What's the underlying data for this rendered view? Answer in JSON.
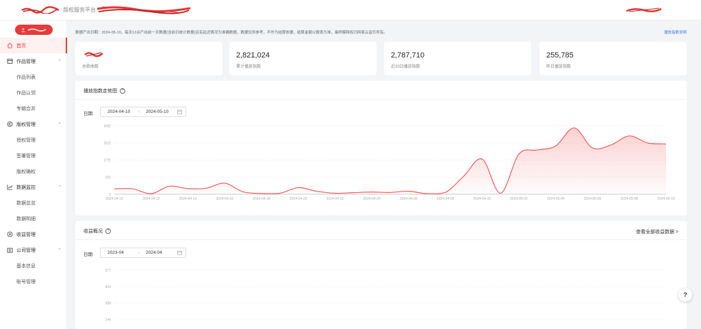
{
  "header": {
    "platform_label": "版权服务平台"
  },
  "sidebar": {
    "primary_button_icon": "upload-icon",
    "nav": [
      {
        "label": "首页",
        "type": "group",
        "active": true,
        "icon": "home-icon"
      },
      {
        "label": "作品管理",
        "type": "group",
        "expanded": true,
        "icon": "works-icon"
      },
      {
        "label": "作品列表",
        "type": "sub"
      },
      {
        "label": "作品认领",
        "type": "sub"
      },
      {
        "label": "专辑合并",
        "type": "sub"
      },
      {
        "label": "版权管理",
        "type": "group",
        "expanded": true,
        "icon": "copyright-icon"
      },
      {
        "label": "授权管理",
        "type": "sub"
      },
      {
        "label": "签署管理",
        "type": "sub"
      },
      {
        "label": "版权确权",
        "type": "sub"
      },
      {
        "label": "数据监控",
        "type": "group",
        "expanded": true,
        "icon": "chart-icon"
      },
      {
        "label": "数据总览",
        "type": "sub"
      },
      {
        "label": "数据明细",
        "type": "sub"
      },
      {
        "label": "收益管理",
        "type": "group",
        "icon": "income-icon"
      },
      {
        "label": "公司管理",
        "type": "group",
        "expanded": true,
        "icon": "company-icon"
      },
      {
        "label": "基本信息",
        "type": "sub"
      },
      {
        "label": "账号管理",
        "type": "sub"
      }
    ]
  },
  "notice": {
    "text": "数据产出日期：2024-05-10，每天12点产出前一天数据(含前日统计数据)且有延迟情况为准确数据，数据仅供参考，不作为结算依据，结算金额以报表为准，最终解释权归网易云音乐所有。",
    "link": "播放指数说明"
  },
  "stats": [
    {
      "value": "",
      "label": "总歌曲数"
    },
    {
      "value": "2,821,024",
      "label": "累计播放指数"
    },
    {
      "value": "2,787,710",
      "label": "近30日播放指数"
    },
    {
      "value": "255,785",
      "label": "昨日播放指数"
    }
  ],
  "trend_panel": {
    "title": "播放指数走势图",
    "date_label": "日期:",
    "start_date": "2024-04-10",
    "end_date": "2024-05-10",
    "arrow": "→"
  },
  "income_panel": {
    "title": "收益概况",
    "date_label": "日期:",
    "start_date": "2023-04",
    "end_date": "2024-04",
    "arrow": "→",
    "more_link": "查看全部收益数据 >"
  },
  "help_button": "?",
  "colors": {
    "accent": "#e83a3a",
    "link": "#3b7de0"
  },
  "chart_data": [
    {
      "type": "area",
      "x": [
        "2024-04-10",
        "2024-04-11",
        "2024-04-12",
        "2024-04-13",
        "2024-04-14",
        "2024-04-15",
        "2024-04-16",
        "2024-04-17",
        "2024-04-18",
        "2024-04-19",
        "2024-04-20",
        "2024-04-21",
        "2024-04-22",
        "2024-04-23",
        "2024-04-24",
        "2024-04-25",
        "2024-04-26",
        "2024-04-27",
        "2024-04-28",
        "2024-04-29",
        "2024-04-30",
        "2024-05-01",
        "2024-05-02",
        "2024-05-03",
        "2024-05-04",
        "2024-05-05",
        "2024-05-06",
        "2024-05-07",
        "2024-05-08",
        "2024-05-09",
        "2024-05-10"
      ],
      "xtick_labels": [
        "2024-04-10",
        "2024-04-12",
        "2024-04-14",
        "2024-04-16",
        "2024-04-18",
        "2024-04-20",
        "2024-04-22",
        "2024-04-24",
        "2024-04-26",
        "2024-04-28",
        "2024-04-30",
        "2024-05-02",
        "2024-05-04",
        "2024-05-06",
        "2024-05-08",
        "2024-05-10"
      ],
      "values": [
        27000,
        27000,
        3000,
        40000,
        28000,
        30000,
        55000,
        12000,
        4000,
        5000,
        33000,
        15000,
        5000,
        8000,
        11000,
        9000,
        15000,
        3000,
        9000,
        90000,
        175000,
        5000,
        200000,
        220000,
        240000,
        330000,
        230000,
        245000,
        290000,
        255000,
        250000
      ],
      "ytick_labels": [
        "0",
        "8万",
        "17万",
        "25万",
        "34万"
      ],
      "ylim": [
        0,
        340000
      ],
      "title": "",
      "xlabel": "",
      "ylabel": "",
      "grid": true,
      "color": "#f15a5a"
    },
    {
      "type": "area",
      "ytick_labels": [
        "577",
        "433",
        "288",
        "144"
      ],
      "title": "",
      "xlabel": "",
      "ylabel": ""
    }
  ]
}
